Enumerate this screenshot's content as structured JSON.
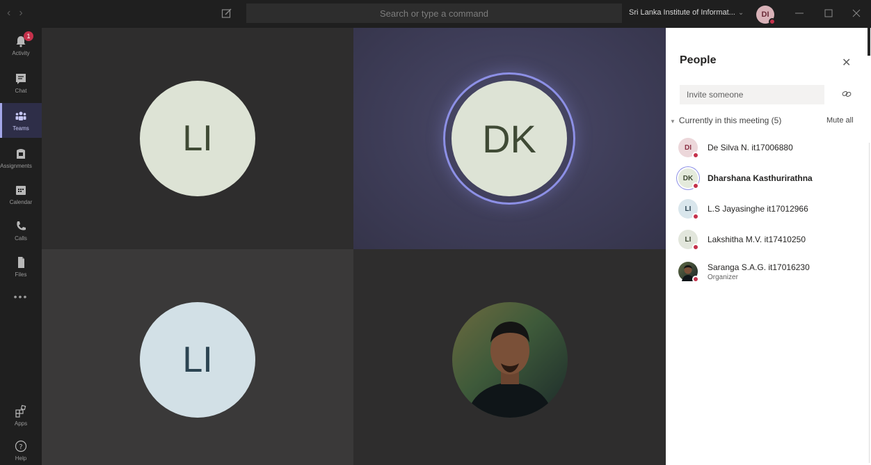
{
  "titlebar": {
    "search_placeholder": "Search or type a command",
    "org_name": "Sri Lanka Institute of Informat...",
    "user_initials": "DI"
  },
  "rail": {
    "items": [
      {
        "label": "Activity",
        "icon": "bell-icon",
        "badge": "1"
      },
      {
        "label": "Chat",
        "icon": "chat-icon"
      },
      {
        "label": "Teams",
        "icon": "teams-icon",
        "active": true
      },
      {
        "label": "Assignments",
        "icon": "assignments-icon"
      },
      {
        "label": "Calendar",
        "icon": "calendar-icon"
      },
      {
        "label": "Calls",
        "icon": "phone-icon"
      },
      {
        "label": "Files",
        "icon": "file-icon"
      }
    ],
    "more": "•••",
    "bottom": [
      {
        "label": "Apps",
        "icon": "apps-icon"
      },
      {
        "label": "Help",
        "icon": "help-icon"
      }
    ]
  },
  "stage": {
    "tiles": [
      {
        "initials": "LI",
        "color": "#dde3d5",
        "text_color": "#3f4a35"
      },
      {
        "initials": "DK",
        "color": "#dde3d5",
        "text_color": "#3f4a35",
        "speaking": true
      },
      {
        "initials": "LI",
        "color": "#d2e0e6",
        "text_color": "#2c4452"
      },
      {
        "photo": "person-photo"
      }
    ]
  },
  "people": {
    "title": "People",
    "invite_placeholder": "Invite someone",
    "section_label": "Currently in this meeting (5)",
    "mute_all": "Mute all",
    "participants": [
      {
        "initials": "DI",
        "name": "De Silva N. it17006880",
        "bg": "#ecd7da",
        "fg": "#8a2f43"
      },
      {
        "initials": "DK",
        "name": "Dharshana Kasthurirathna",
        "bg": "#e4eadc",
        "fg": "#3f4a35",
        "bold": true,
        "ring": true
      },
      {
        "initials": "LI",
        "name": "L.S Jayasinghe it17012966",
        "bg": "#d9e6ec",
        "fg": "#2c4452"
      },
      {
        "initials": "LI",
        "name": "Lakshitha M.V. it17410250",
        "bg": "#e2e6dc",
        "fg": "#3f4a35"
      },
      {
        "initials": "",
        "name": "Saranga S.A.G. it17016230",
        "role": "Organizer",
        "photo": true
      }
    ]
  }
}
